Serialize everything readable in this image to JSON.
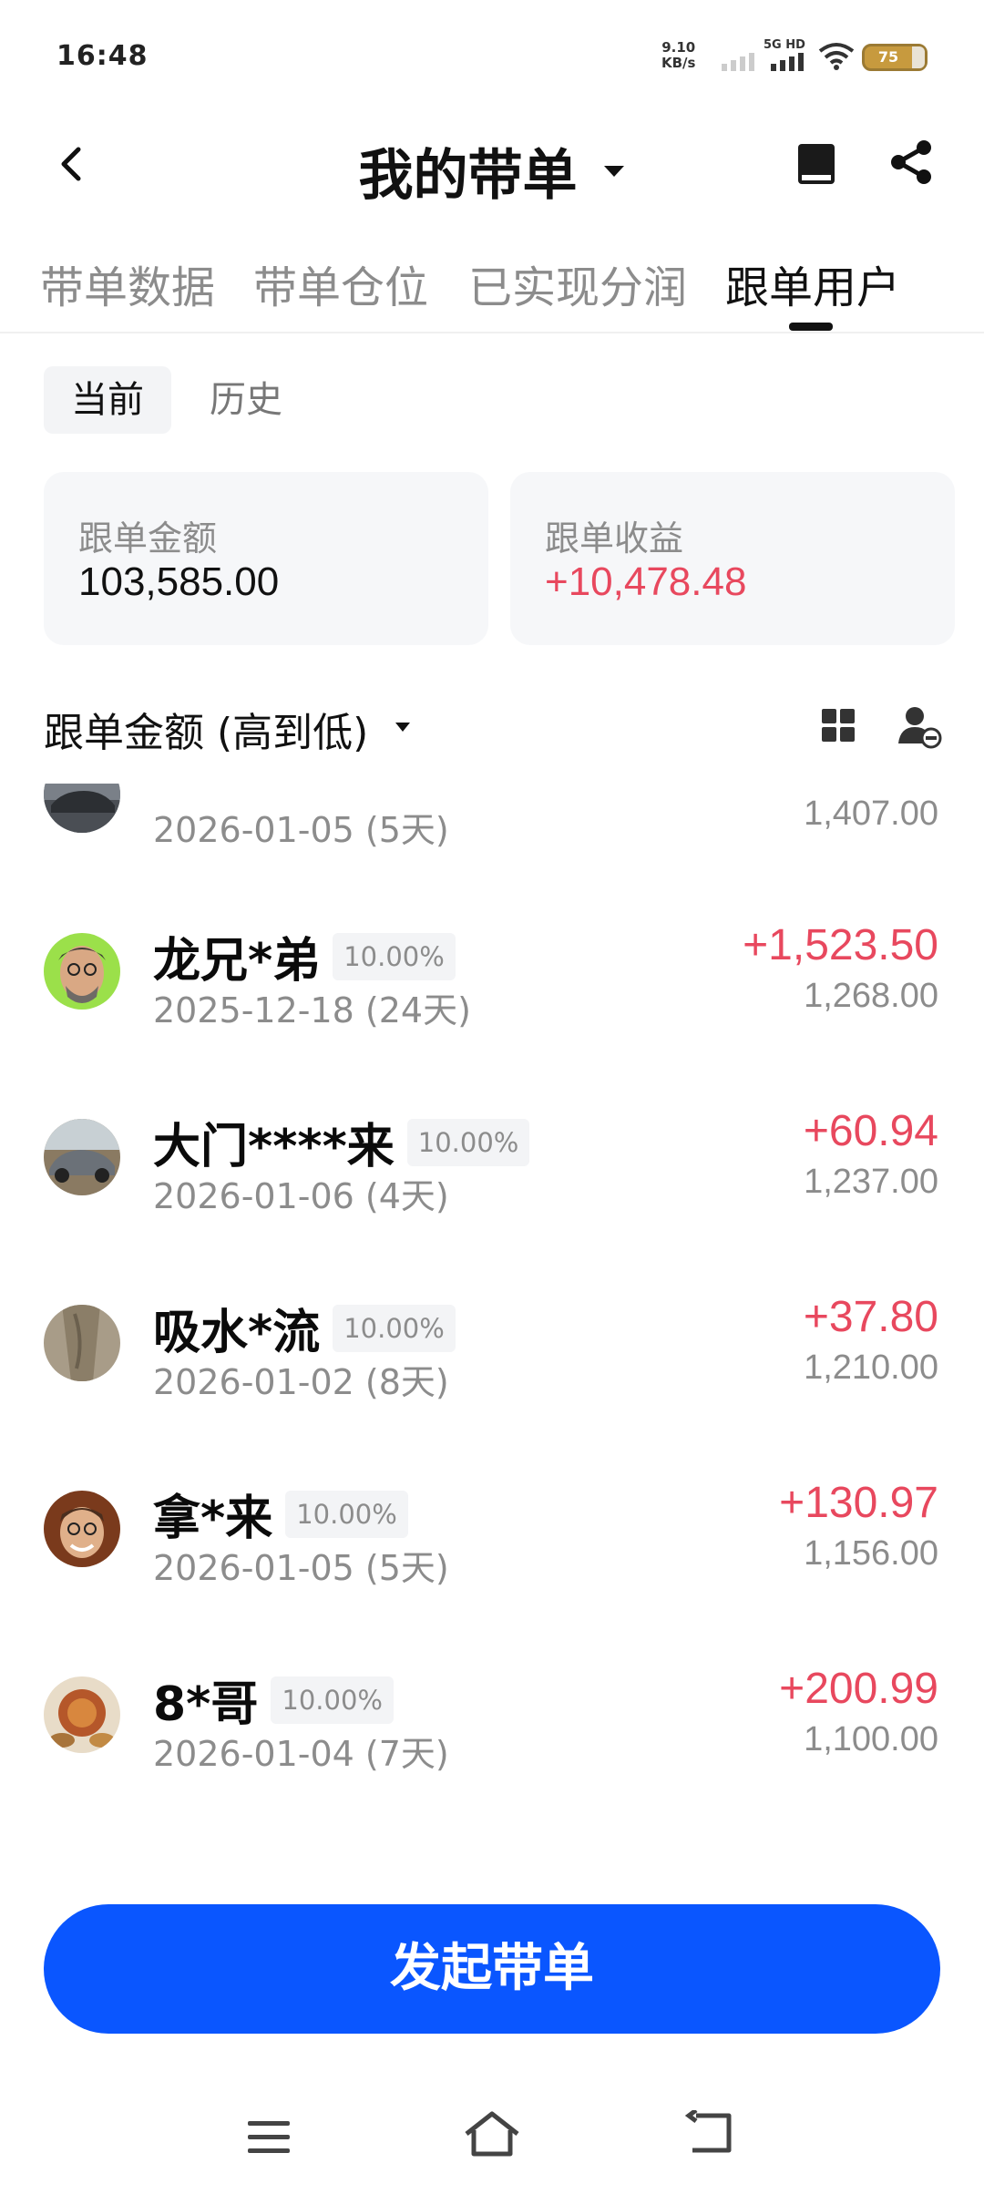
{
  "status_bar": {
    "time": "16:48",
    "speed_value": "9.10",
    "speed_unit": "KB/s",
    "network": "5G HD",
    "battery": "75"
  },
  "header": {
    "title": "我的带单",
    "icons": [
      "back-icon",
      "chevron-down-icon",
      "book-icon",
      "share-icon"
    ]
  },
  "tabs": [
    {
      "label": "带单数据",
      "active": false
    },
    {
      "label": "带单仓位",
      "active": false
    },
    {
      "label": "已实现分润",
      "active": false
    },
    {
      "label": "跟单用户",
      "active": true
    }
  ],
  "segment": [
    {
      "label": "当前",
      "active": true
    },
    {
      "label": "历史",
      "active": false
    }
  ],
  "summary": {
    "amount_label": "跟单金额",
    "amount_value": "103,585.00",
    "profit_label": "跟单收益",
    "profit_value": "+10,478.48"
  },
  "sort": {
    "label": "跟单金额 (高到低)",
    "icons": [
      "grid-icon",
      "user-remove-icon"
    ]
  },
  "followers": [
    {
      "name": "",
      "ratio": "",
      "date": "2026-01-05 (5天)",
      "profit": "",
      "amount": "1,407.00",
      "avatar": "car"
    },
    {
      "name": "龙兄*弟",
      "ratio": "10.00%",
      "date": "2025-12-18 (24天)",
      "profit": "+1,523.50",
      "amount": "1,268.00",
      "avatar": "portrait-green"
    },
    {
      "name": "大门****来",
      "ratio": "10.00%",
      "date": "2026-01-06 (4天)",
      "profit": "+60.94",
      "amount": "1,237.00",
      "avatar": "car"
    },
    {
      "name": "吸水*流",
      "ratio": "10.00%",
      "date": "2026-01-02 (8天)",
      "profit": "+37.80",
      "amount": "1,210.00",
      "avatar": "wood"
    },
    {
      "name": "拿*来",
      "ratio": "10.00%",
      "date": "2026-01-05 (5天)",
      "profit": "+130.97",
      "amount": "1,156.00",
      "avatar": "portrait-brown"
    },
    {
      "name": "8*哥",
      "ratio": "10.00%",
      "date": "2026-01-04 (7天)",
      "profit": "+200.99",
      "amount": "1,100.00",
      "avatar": "food"
    }
  ],
  "cta": {
    "label": "发起带单"
  },
  "colors": {
    "accent": "#0a56ff",
    "positive": "#e8485e",
    "muted": "#8c8c8c"
  },
  "nav": {
    "icons": [
      "menu-icon",
      "home-icon",
      "back-nav-icon"
    ]
  }
}
